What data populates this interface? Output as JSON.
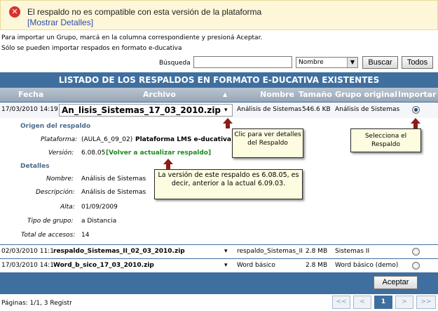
{
  "error": {
    "icon": "error-icon",
    "message": "El respaldo no es compatible con esta versión de la plataforma",
    "details_link": "[Mostrar Detalles]"
  },
  "instructions": {
    "line1": "Para importar un Grupo, marcá en la columna correspondiente y presioná Aceptar.",
    "line2": "Sólo se pueden importar respados en formato e-ducativa"
  },
  "search": {
    "label": "Búsqueda",
    "value": "",
    "sort_selected": "Nombre",
    "search_button": "Buscar",
    "all_button": "Todos"
  },
  "table": {
    "title": "LISTADO DE LOS RESPALDOS EN FORMATO E-DUCATIVA EXISTENTES",
    "headers": {
      "fecha": "Fecha",
      "archivo": "Archivo",
      "sort_glyph": "▲",
      "nombre": "Nombre",
      "tamano": "Tamaño",
      "grupo": "Grupo original",
      "importar": "Importar"
    },
    "rows": [
      {
        "fecha": "17/03/2010 14:19",
        "archivo": "An_lisis_Sistemas_17_03_2010.zip",
        "nombre": "Análisis de Sistemas",
        "tamano": "546.6 KB",
        "grupo": "Análisis de Sistemas",
        "selected": true
      },
      {
        "fecha": "02/03/2010 11:1",
        "archivo": "respaldo_Sistemas_II_02_03_2010.zip",
        "nombre": "respaldo_Sistemas_II",
        "tamano": "2.8 MB",
        "grupo": "Sistemas II",
        "selected": false
      },
      {
        "fecha": "17/03/2010 14:1",
        "archivo": "Word_b_sico_17_03_2010.zip",
        "nombre": "Word básico",
        "tamano": "2.8 MB",
        "grupo": "Word básico (demo)",
        "selected": false
      }
    ],
    "dropdown_glyph": "▾"
  },
  "details": {
    "origin_title": "Origen del respaldo",
    "plataforma_label": "Plataforma:",
    "plataforma_code": "(AULA_6_09_02)",
    "plataforma_name": "Plataforma LMS e-ducativa",
    "version_label": "Versión:",
    "version_value": "6.08.05",
    "version_link": "[Volver a actualizar respaldo]",
    "details_title": "Detalles",
    "nombre_label": "Nombre:",
    "nombre_value": "Análisis de Sistemas",
    "descripcion_label": "Descripción:",
    "descripcion_value": "Análisis de Sistemas",
    "alta_label": "Alta:",
    "alta_value": "01/09/2009",
    "tipo_label": "Tipo de grupo:",
    "tipo_value": "a Distancia",
    "accesos_label": "Total de accesos:",
    "accesos_value": "14"
  },
  "callouts": {
    "detalles": "Clic para ver detalles del Respaldo",
    "selecciona": "Selecciona el Respaldo",
    "version": "La versión de este respaldo es 6.08.05, es decir, anterior a la actual 6.09.03."
  },
  "footer": {
    "accept_button": "Aceptar",
    "pages_text": "Páginas: 1/1, 3 Registr",
    "pager": {
      "first": "<<",
      "prev": "<",
      "current": "1",
      "next": ">",
      "last": ">>"
    }
  },
  "colors": {
    "table_header": "#3f6f9f",
    "error_bg": "#fdf6d9",
    "callout_bg": "#fdfbe0",
    "arrow": "#8a1c14"
  }
}
